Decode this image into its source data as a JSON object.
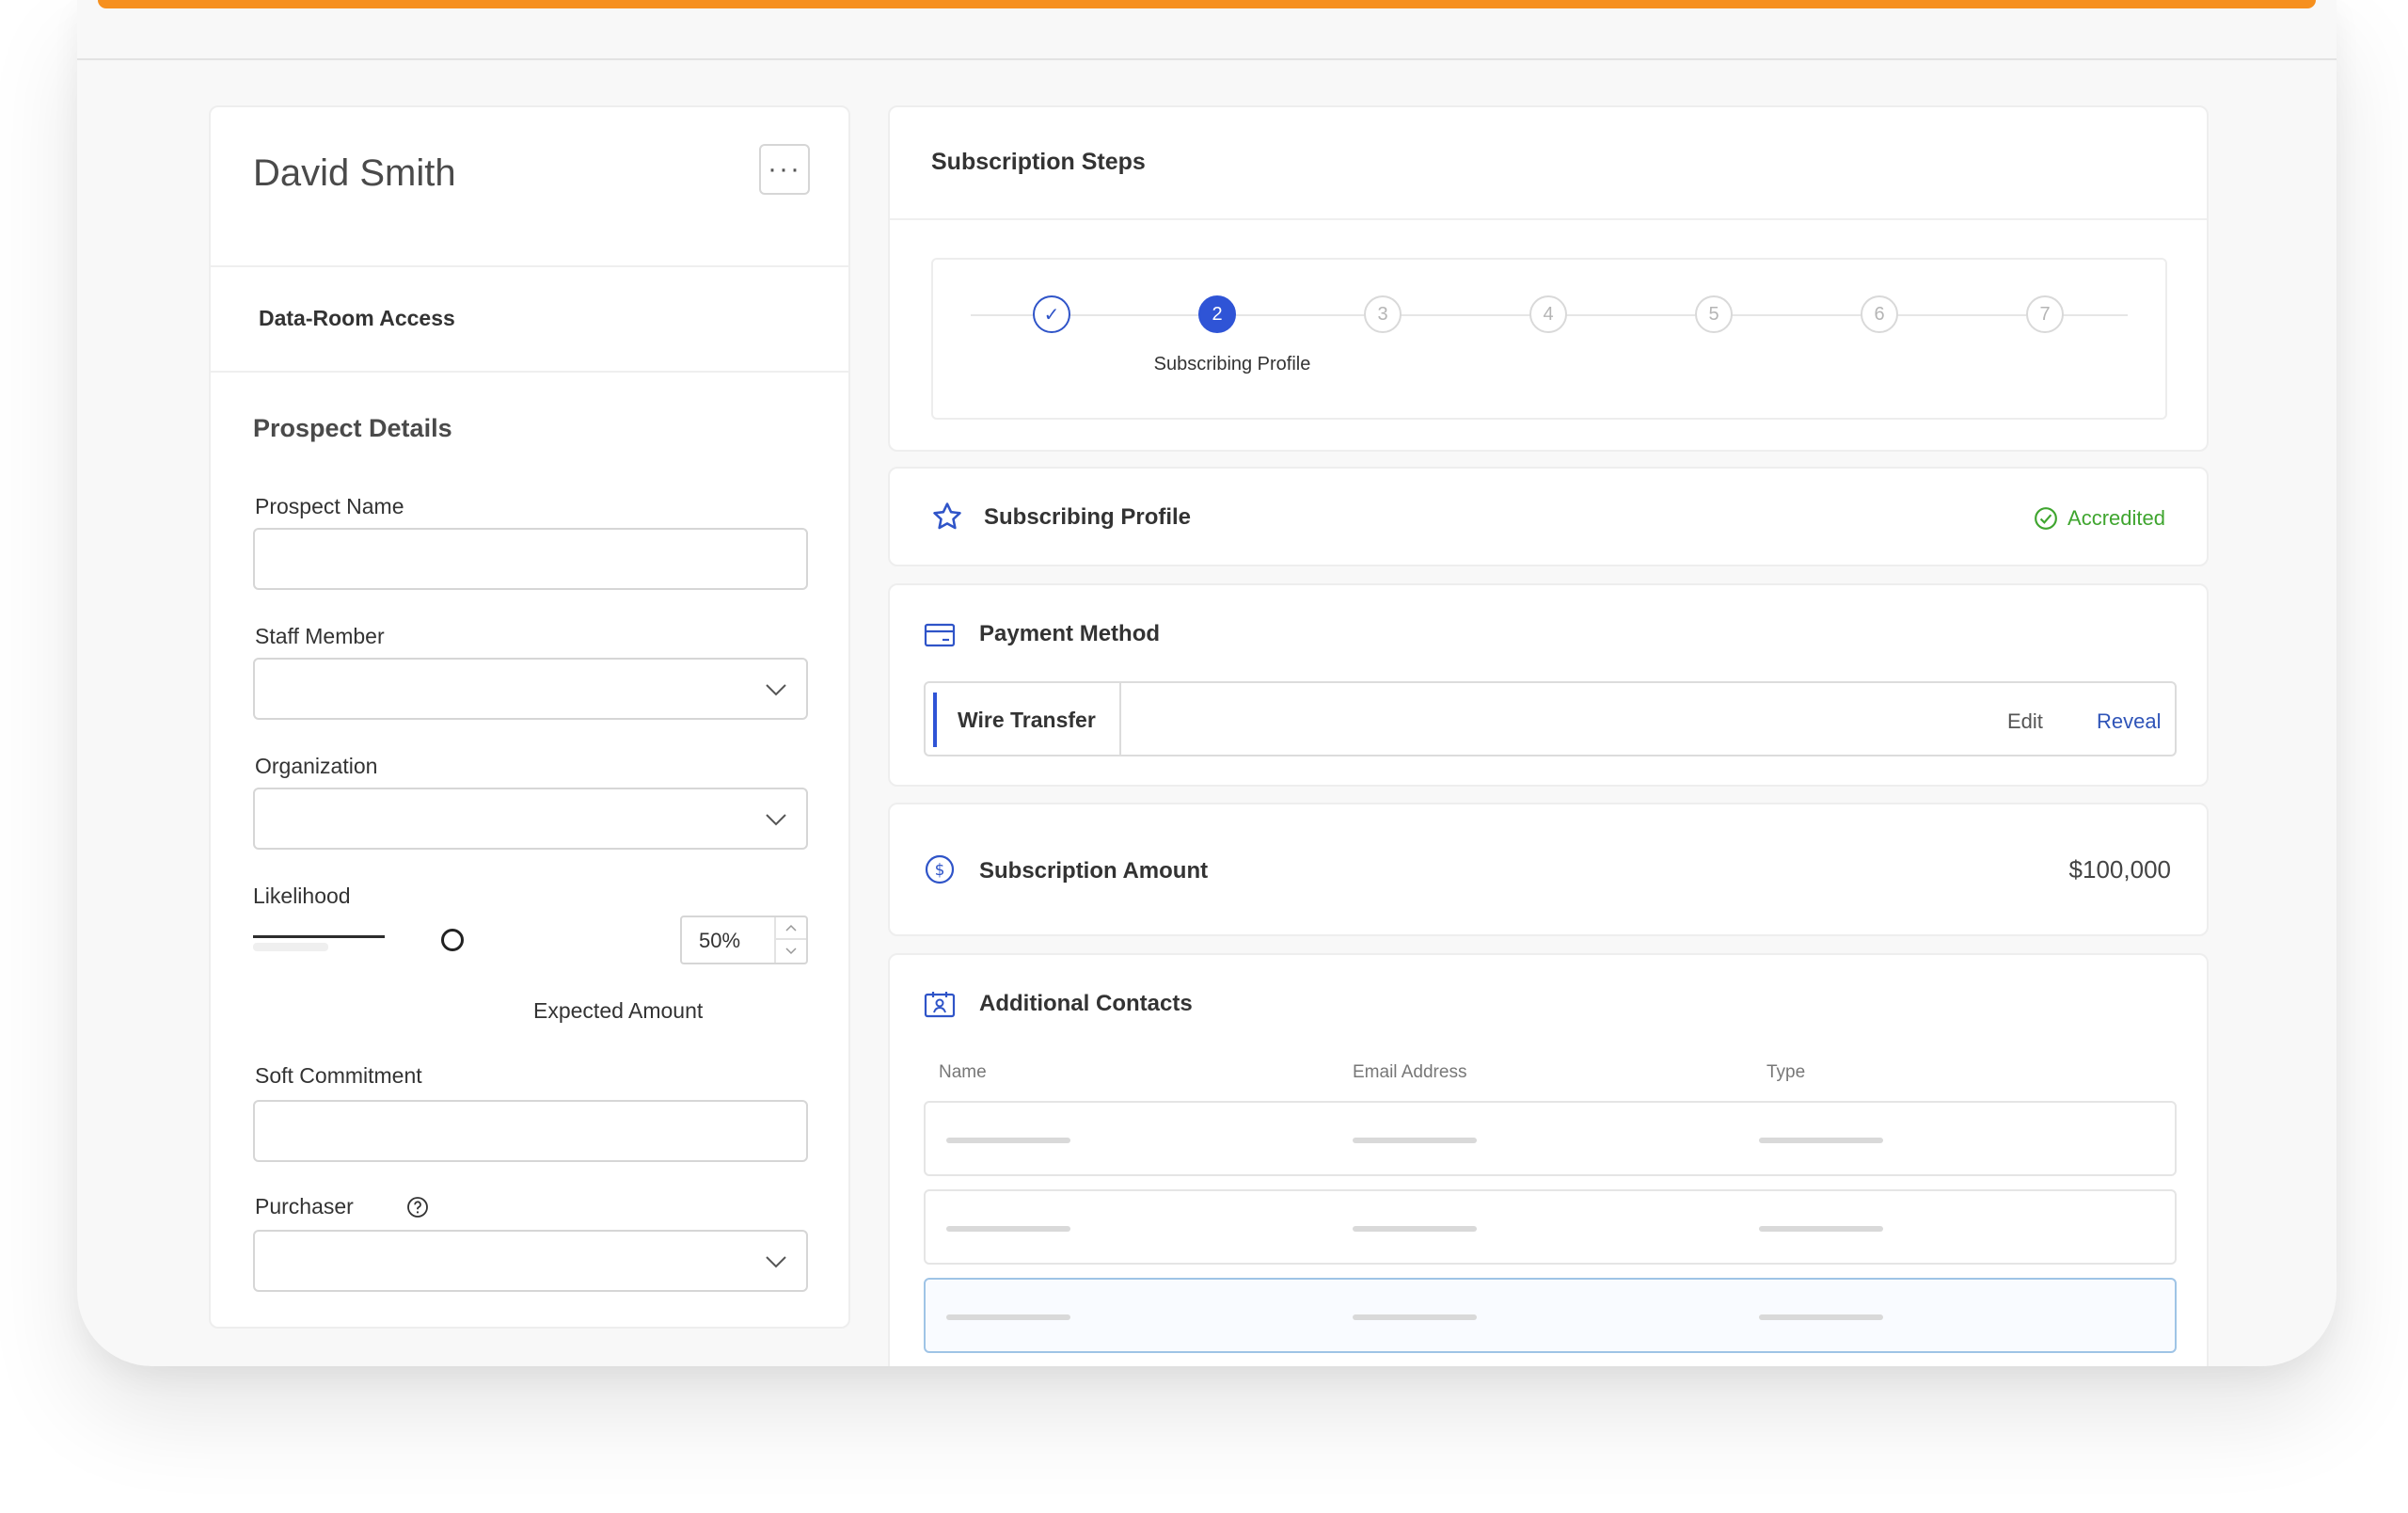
{
  "prospect": {
    "name": "David Smith",
    "more_label": "···",
    "data_room_label": "Data-Room Access",
    "section_title": "Prospect Details",
    "fields": {
      "prospect_name": "Prospect Name",
      "staff_member": "Staff Member",
      "organization": "Organization",
      "likelihood": "Likelihood",
      "likelihood_value": "50%",
      "expected_amount": "Expected Amount",
      "soft_commitment": "Soft Commitment",
      "purchaser": "Purchaser"
    }
  },
  "steps": {
    "title": "Subscription Steps",
    "items": [
      "✓",
      "2",
      "3",
      "4",
      "5",
      "6",
      "7"
    ],
    "active_label": "Subscribing Profile"
  },
  "profile": {
    "title": "Subscribing Profile",
    "status": "Accredited"
  },
  "payment": {
    "title": "Payment Method",
    "method": "Wire Transfer",
    "edit_label": "Edit",
    "reveal_label": "Reveal"
  },
  "amount": {
    "title": "Subscription Amount",
    "value": "$100,000"
  },
  "contacts": {
    "title": "Additional Contacts",
    "columns": [
      "Name",
      "Email Address",
      "Type"
    ]
  },
  "colors": {
    "accent": "#f6901e",
    "primary": "#2f54d6",
    "success": "#3fa52f"
  }
}
